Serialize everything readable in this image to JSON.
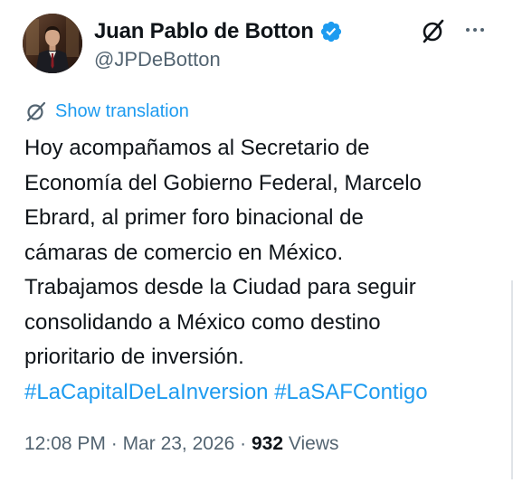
{
  "author": {
    "display_name": "Juan Pablo de Botton",
    "handle": "@JPDeBotton",
    "verified": true
  },
  "actions": {
    "grok_icon": "grok-slash-circle-icon",
    "more_icon": "more-horizontal-icon"
  },
  "translation": {
    "label": "Show translation"
  },
  "tweet": {
    "lines": [
      "Hoy acompañamos al Secretario de",
      "Economía del Gobierno Federal, Marcelo",
      "Ebrard, al primer foro binacional de",
      "cámaras de comercio en México.",
      "Trabajamos desde la Ciudad para seguir",
      "consolidando a México como destino",
      "prioritario de inversión."
    ],
    "hashtags": [
      "#LaCapitalDeLaInversion",
      "#LaSAFContigo"
    ]
  },
  "meta": {
    "time": "12:08 PM",
    "separator": " · ",
    "date": "Mar 23, 2026",
    "views_count": "932",
    "views_label": "Views"
  },
  "colors": {
    "link": "#1d9bf0",
    "secondary_text": "#536471",
    "primary_text": "#0f1419",
    "verified_badge": "#1d9bf0"
  }
}
